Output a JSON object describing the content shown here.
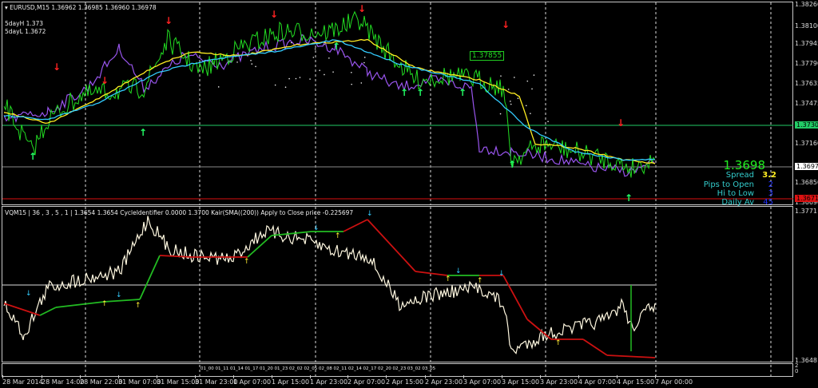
{
  "header": {
    "symbol_line": "EURUSD,M15  1.36962 1.36985 1.36960 1.36978",
    "five_day_high": "5dayH 1.373",
    "five_day_low": "5dayL 1.3672"
  },
  "indicator": {
    "title": "VQM15 | 36 , 3 , 5 , 1 |  1.3654 1.3654  CycleIdentifier 0.0000 1.3700  Kair(SMA((200)) Apply to Close price -0.225697"
  },
  "main_axis": [
    "1.38260",
    "1.38100",
    "1.37945",
    "1.37790",
    "1.37635",
    "1.37475",
    "1.37160",
    "1.36850",
    "1.36690"
  ],
  "highlight_prices": {
    "green_line": "1.37303",
    "current": "1.36978",
    "red_line": "1.36719"
  },
  "callout_price": "1.37855",
  "stats": {
    "price": "1.3698",
    "spread_label": "Spread",
    "spread_value": "3.2",
    "pips_label": "Pips to Open",
    "pips_value": "2",
    "hilo_label": "Hi to Low",
    "hilo_value": "3",
    "daily_label": "Daily Av",
    "daily_value": "45"
  },
  "ind_axis": {
    "top": "1.3771",
    "bottom": "1.3648"
  },
  "sub_axis": {
    "top": "2",
    "bottom": "0"
  },
  "sub_labels": "01_00 01_11 01_14 01_17 01_20 01_23 02_02 02_05 02_08 02_11 02_14 02_17 02_20 02_23 03_02 03_05",
  "time_axis": [
    "28 Mar 2014",
    "28 Mar 14:00",
    "28 Mar 22:00",
    "31 Mar 07:00",
    "31 Mar 15:00",
    "31 Mar 23:00",
    "1 Apr 07:00",
    "1 Apr 15:00",
    "1 Apr 23:00",
    "2 Apr 07:00",
    "2 Apr 15:00",
    "2 Apr 23:00",
    "3 Apr 07:00",
    "3 Apr 15:00",
    "3 Apr 23:00",
    "4 Apr 07:00",
    "4 Apr 15:00",
    "7 Apr 00:00"
  ],
  "colors": {
    "price": "#22dd22",
    "alt": "#9955ee",
    "up": "#22ff66",
    "down": "#ff2222",
    "osc": "#fff8e0",
    "signal_down": "#cc1111",
    "signal_up": "#22bb22"
  }
}
